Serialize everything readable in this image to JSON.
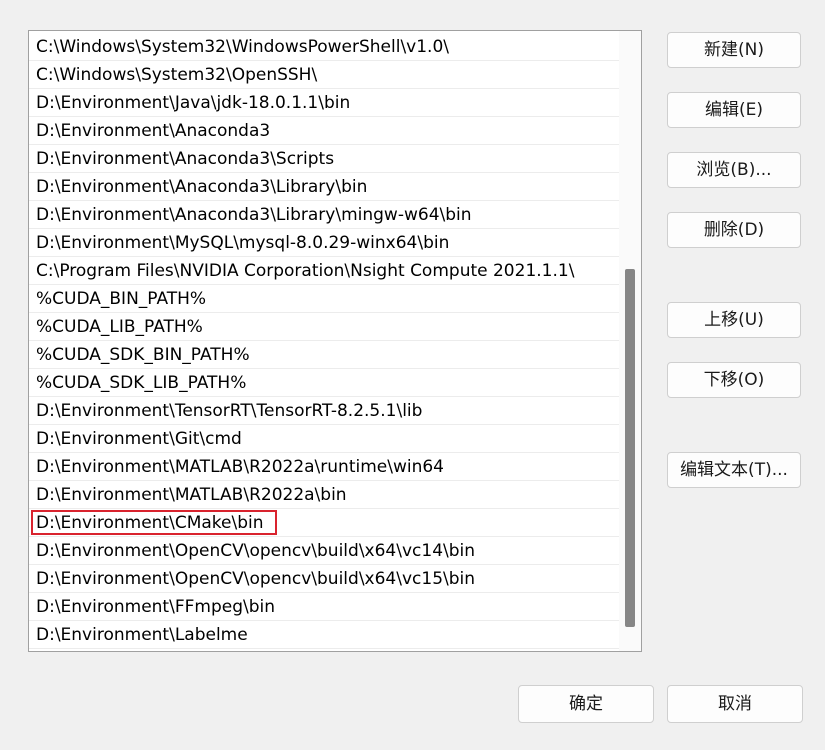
{
  "path_list": {
    "items": [
      "C:\\Windows\\System32\\WindowsPowerShell\\v1.0\\",
      "C:\\Windows\\System32\\OpenSSH\\",
      "D:\\Environment\\Java\\jdk-18.0.1.1\\bin",
      "D:\\Environment\\Anaconda3",
      "D:\\Environment\\Anaconda3\\Scripts",
      "D:\\Environment\\Anaconda3\\Library\\bin",
      "D:\\Environment\\Anaconda3\\Library\\mingw-w64\\bin",
      "D:\\Environment\\MySQL\\mysql-8.0.29-winx64\\bin",
      "C:\\Program Files\\NVIDIA Corporation\\Nsight Compute 2021.1.1\\",
      "%CUDA_BIN_PATH%",
      "%CUDA_LIB_PATH%",
      "%CUDA_SDK_BIN_PATH%",
      "%CUDA_SDK_LIB_PATH%",
      "D:\\Environment\\TensorRT\\TensorRT-8.2.5.1\\lib",
      "D:\\Environment\\Git\\cmd",
      "D:\\Environment\\MATLAB\\R2022a\\runtime\\win64",
      "D:\\Environment\\MATLAB\\R2022a\\bin",
      "D:\\Environment\\CMake\\bin",
      "D:\\Environment\\OpenCV\\opencv\\build\\x64\\vc14\\bin",
      "D:\\Environment\\OpenCV\\opencv\\build\\x64\\vc15\\bin",
      "D:\\Environment\\FFmpeg\\bin",
      "D:\\Environment\\Labelme"
    ]
  },
  "buttons": {
    "new": "新建(N)",
    "edit": "编辑(E)",
    "browse": "浏览(B)...",
    "delete": "删除(D)",
    "move_up": "上移(U)",
    "move_down": "下移(O)",
    "edit_text": "编辑文本(T)...",
    "ok": "确定",
    "cancel": "取消"
  },
  "colors": {
    "highlight_border": "#d9232e",
    "scroll_thumb": "#868686"
  }
}
